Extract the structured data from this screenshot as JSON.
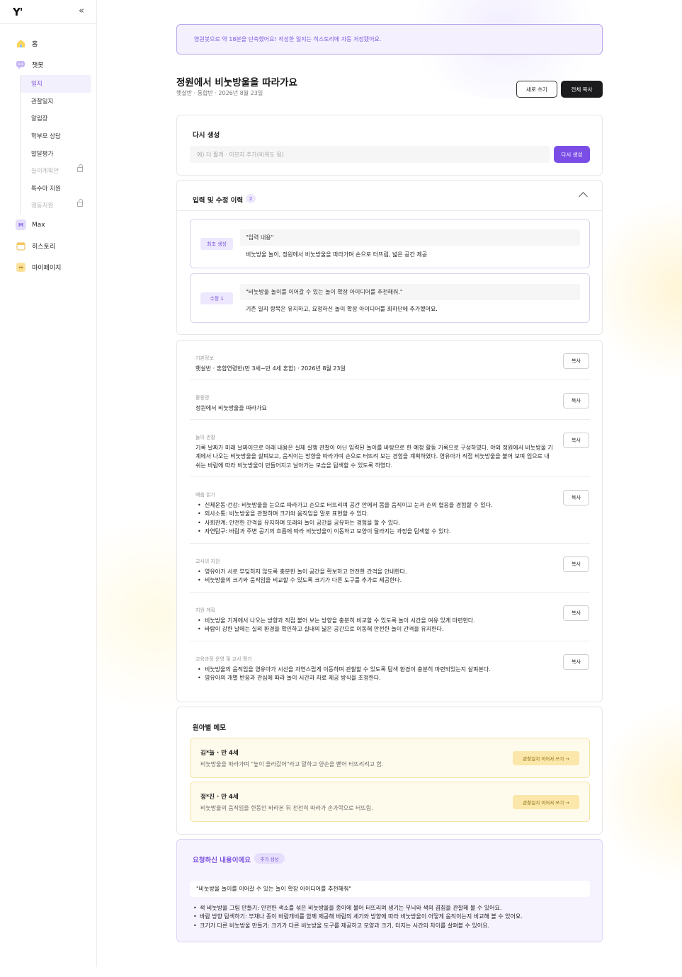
{
  "sidebar": {
    "logo": "Y'",
    "collapse_icon": "«",
    "nav": [
      {
        "label": "홈",
        "icon": "home-icon"
      },
      {
        "label": "챗봇",
        "icon": "chatbot-icon"
      }
    ],
    "sub": [
      {
        "label": "일지",
        "active": true
      },
      {
        "label": "관찰일지"
      },
      {
        "label": "알림장"
      },
      {
        "label": "학부모 상담"
      },
      {
        "label": "발달평가"
      },
      {
        "label": "놀이계획안",
        "locked": true
      },
      {
        "label": "특수아 지원"
      },
      {
        "label": "행동지원",
        "locked": true
      }
    ],
    "nav2": [
      {
        "label": "Max",
        "icon": "max-icon"
      },
      {
        "label": "히스토리",
        "icon": "history-icon"
      },
      {
        "label": "마이페이지",
        "icon": "mypage-icon"
      }
    ]
  },
  "banner": "영원봇으로 약 18분을 단축했어요! 작성한 일지는 히스토리에 자동 저장됐어요.",
  "header": {
    "title": "정원에서 비눗방울을 따라가요",
    "subtitle": "햇살반 · 통합반 · 2026년 8월 23일",
    "new_label": "새로 쓰기",
    "copy_all_label": "전체 복사"
  },
  "regen": {
    "label": "다시 생성",
    "placeholder": "예) 더 짧게 · 이모지 추가(비워도 됨)",
    "button": "다시 생성"
  },
  "history": {
    "title": "입력 및 수정 이력",
    "count": "2",
    "items": [
      {
        "tag": "최초 생성",
        "q": "\"입력 내용\"",
        "a": "비눗방울 놀이, 정원에서 비눗방울을 따라가며 손으로 터뜨림, 넓은 공간 제공"
      },
      {
        "tag": "수정 1",
        "q": "\"비눗방울 놀이를 이어갈 수 있는 놀이 확장 아이디어를 추천해줘.\"",
        "a": "기존 일지 항목은 유지하고, 요청하신 놀이 확장 아이디어를 최하단에 추가했어요."
      }
    ]
  },
  "log": {
    "copy_label": "복사",
    "sections": [
      {
        "label": "기본정보",
        "text": "햇살반 · 혼합연령반(만 3세~만 4세 혼합) · 2026년 8월 23일"
      },
      {
        "label": "활동명",
        "text": "정원에서 비눗방울을 따라가요"
      },
      {
        "label": "놀이 관찰",
        "text": "기록 날짜가 미래 날짜이므로 아래 내용은 실제 실행 관찰이 아닌 입력된 놀이를 바탕으로 한 예정 활동 기록으로 구성하였다. 야외 정원에서 비눗방울 기계에서 나오는 비눗방울을 살펴보고, 움직이는 방향을 따라가며 손으로 터뜨려 보는 경험을 계획하였다. 영유아가 직접 비눗방울을 불어 보며 입으로 내쉬는 바람에 따라 비눗방울이 만들어지고 날아가는 모습을 탐색할 수 있도록 하였다."
      },
      {
        "label": "배움 읽기",
        "items": [
          "신체운동·건강: 비눗방울을 눈으로 따라가고 손으로 터뜨리며 공간 안에서 몸을 움직이고 눈과 손의 협응을 경험할 수 있다.",
          "의사소통: 비눗방울을 관찰하며 크기와 움직임을 말로 표현할 수 있다.",
          "사회관계: 안전한 간격을 유지하며 또래와 놀이 공간을 공유하는 경험을 할 수 있다.",
          "자연탐구: 바람과 주변 공기의 흐름에 따라 비눗방울이 이동하고 모양이 달라지는 과정을 탐색할 수 있다."
        ]
      },
      {
        "label": "교사의 지원",
        "items": [
          "영유아가 서로 부딪히지 않도록 충분한 놀이 공간을 확보하고 안전한 간격을 안내한다.",
          "비눗방울의 크기와 움직임을 비교할 수 있도록 크기가 다른 도구를 추가로 제공한다."
        ]
      },
      {
        "label": "지원 계획",
        "items": [
          "비눗방울 기계에서 나오는 방향과 직접 불어 보는 방향을 충분히 비교할 수 있도록 놀이 시간을 여유 있게 마련한다.",
          "바람이 강한 날에는 실외 환경을 확인하고 실내의 넓은 공간으로 이동해 안전한 놀이 간격을 유지한다."
        ]
      },
      {
        "label": "교육과정 운영 및 교사 평가",
        "items": [
          "비눗방울의 움직임을 영유아가 시선을 자연스럽게 이동하며 관찰할 수 있도록 탐색 환경이 충분히 마련되었는지 살펴본다.",
          "영유아의 개별 반응과 관심에 따라 놀이 시간과 자료 제공 방식을 조정한다."
        ]
      }
    ]
  },
  "memo": {
    "title": "원아별 메모",
    "button": "관찰일지 이어서 쓰기 →",
    "items": [
      {
        "name": "김*늘 · 만 4세",
        "desc": "비눗방울을 따라가며 \"높이 올라갔어\"라고 말하고 양손을 뻗어 터뜨리려고 함."
      },
      {
        "name": "정*진 · 만 4세",
        "desc": "비눗방울의 움직임을 한동안 바라본 뒤 천천히 따라가 손가락으로 터뜨림."
      }
    ]
  },
  "request": {
    "title": "요청하신 내용이에요",
    "badge": "추가 생성",
    "q": "\"비눗방울 놀이를 이어갈 수 있는 놀이 확장 아이디어를 추천해줘\"",
    "items": [
      "색 비눗방울 그림 만들기: 안전한 색소를 섞은 비눗방울을 종이에 불어 터뜨리며 생기는 무늬와 색의 겹침을 관찰해 볼 수 있어요.",
      "바람 방향 탐색하기: 부채나 종이 바람개비를 함께 제공해 바람의 세기와 방향에 따라 비눗방울이 어떻게 움직이는지 비교해 볼 수 있어요.",
      "크기가 다른 비눗방울 만들기: 크기가 다른 비눗방울 도구를 제공하고 모양과 크기, 터지는 시간의 차이를 살펴볼 수 있어요."
    ]
  }
}
